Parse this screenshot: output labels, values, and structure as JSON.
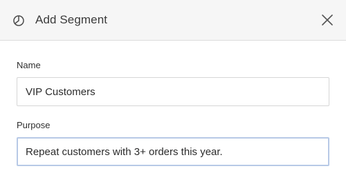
{
  "dialog": {
    "title": "Add Segment",
    "header_icon": "pie-chart-icon",
    "close_icon": "close-icon"
  },
  "form": {
    "name": {
      "label": "Name",
      "value": "VIP Customers"
    },
    "purpose": {
      "label": "Purpose",
      "value": "Repeat customers with 3+ orders this year.",
      "focused": true
    }
  },
  "colors": {
    "header_bg": "#f6f6f6",
    "focus_border": "#b7c9e6",
    "input_border": "#d6d6d6"
  }
}
